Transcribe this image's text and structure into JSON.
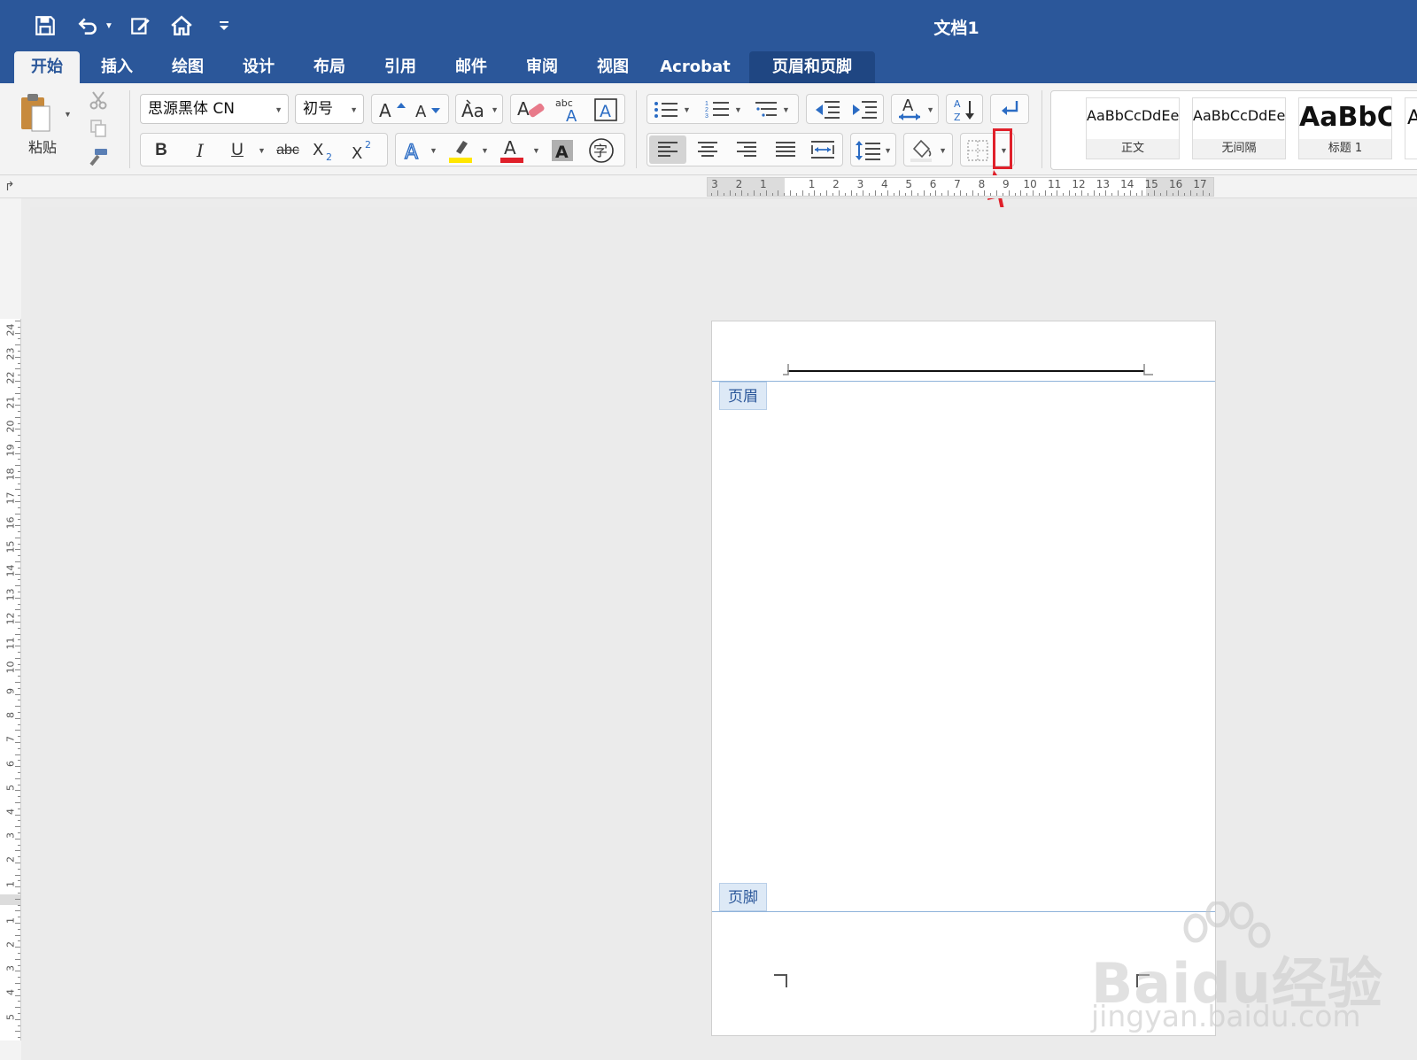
{
  "title_bar": {
    "document_title": "文档1",
    "quick_access": [
      "save-icon",
      "undo-icon",
      "edit-doc-icon",
      "home-icon",
      "customize-toolbar-icon"
    ]
  },
  "tabs": [
    {
      "label": "开始",
      "active": true
    },
    {
      "label": "插入"
    },
    {
      "label": "绘图"
    },
    {
      "label": "设计"
    },
    {
      "label": "布局"
    },
    {
      "label": "引用"
    },
    {
      "label": "邮件"
    },
    {
      "label": "审阅"
    },
    {
      "label": "视图"
    },
    {
      "label": "Acrobat"
    },
    {
      "label": "页眉和页脚",
      "contextual": true
    }
  ],
  "ribbon": {
    "paste_label": "粘贴",
    "font_name": "思源黑体 CN",
    "font_size": "初号",
    "styles": [
      {
        "sample": "AaBbCcDdEe",
        "name": "正文"
      },
      {
        "sample": "AaBbCcDdEe",
        "name": "无间隔"
      },
      {
        "sample": "AaBbC",
        "name": "标题 1"
      },
      {
        "sample": "A",
        "name": ""
      }
    ]
  },
  "ruler": {
    "horizontal_labels": [
      "3",
      "2",
      "1",
      "1",
      "2",
      "3",
      "4",
      "5",
      "6",
      "7",
      "8",
      "9",
      "10",
      "11",
      "12",
      "13",
      "14",
      "15",
      "16",
      "17"
    ],
    "vertical_labels": [
      "24",
      "23",
      "22",
      "21",
      "20",
      "19",
      "18",
      "17",
      "16",
      "15",
      "14",
      "13",
      "12",
      "11",
      "10",
      "9",
      "8",
      "7",
      "6",
      "5",
      "4",
      "3",
      "2",
      "1",
      "1",
      "2",
      "3",
      "4",
      "5"
    ]
  },
  "page": {
    "header_tag": "页眉",
    "footer_tag": "页脚"
  },
  "colors": {
    "title_bar": "#2b579a",
    "ribbon": "#f3f3f3",
    "highlight_annotation": "#e0202a",
    "font_color_bar": "#e0202a",
    "highlighter_bar": "#ffe600"
  },
  "watermark": {
    "logo": "Baidu经验",
    "url": "jingyan.baidu.com"
  }
}
